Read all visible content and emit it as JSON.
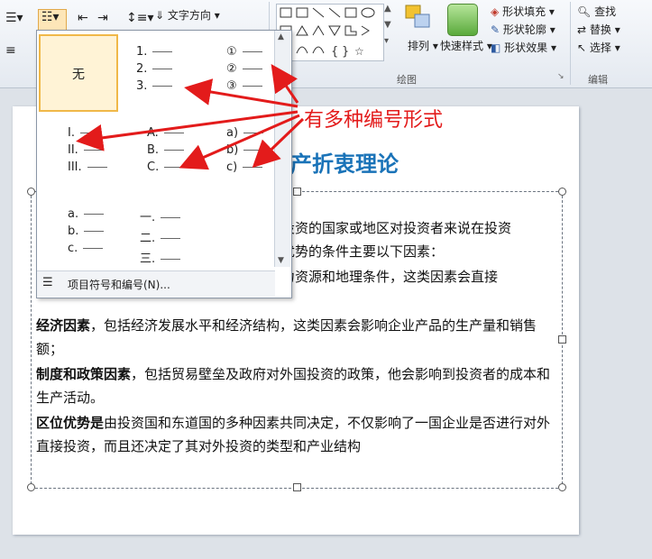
{
  "ribbon": {
    "text_direction_label": "文字方向",
    "sort_label": "排列",
    "quick_styles_label": "快速样式",
    "shape_fill_label": "形状填充",
    "shape_outline_label": "形状轮廓",
    "shape_effects_label": "形状效果",
    "find_label": "查找",
    "replace_label": "替换",
    "select_label": "选择",
    "drawing_group_label": "绘图",
    "editing_group_label": "编辑"
  },
  "numbering_gallery": {
    "none_label": "无",
    "styles": [
      {
        "items": [
          "1.",
          "2.",
          "3."
        ]
      },
      {
        "items": [
          "①",
          "②",
          "③"
        ]
      },
      {
        "items": [
          "I.",
          "II.",
          "III."
        ]
      },
      {
        "items": [
          "A.",
          "B.",
          "C."
        ]
      },
      {
        "items": [
          "a)",
          "b)",
          "c)"
        ]
      },
      {
        "items": [
          "a.",
          "b.",
          "c."
        ]
      },
      {
        "items": [
          "一.",
          "二.",
          "三."
        ]
      }
    ],
    "footer_label": "项目符号和编号(N)..."
  },
  "annotation": "有多种编号形式",
  "document": {
    "title_fragment": "产折衷理论",
    "line1_fragment": "投资的国家或地区对投资者来说在投资",
    "line2_fragment": "优势的条件主要以下因素：",
    "line3_fragment": "力资源和地理条件，这类因素会直接",
    "para_economic_bold": "经济因素",
    "para_economic_text": "，包括经济发展水平和经济结构，这类因素会影响企业产品的生产量和销售额；",
    "para_policy_bold": "制度和政策因素",
    "para_policy_text": "，包括贸易壁垒及政府对外国投资的政策，他会影响到投资者的成本和生产活动。",
    "para_location_bold": "区位优势是",
    "para_location_text": "由投资国和东道国的多种因素共同决定，不仅影响了一国企业是否进行对外直接投资，而且还决定了其对外投资的类型和产业结构"
  },
  "colors": {
    "accent": "#e31b1b",
    "title": "#1a73b8"
  }
}
